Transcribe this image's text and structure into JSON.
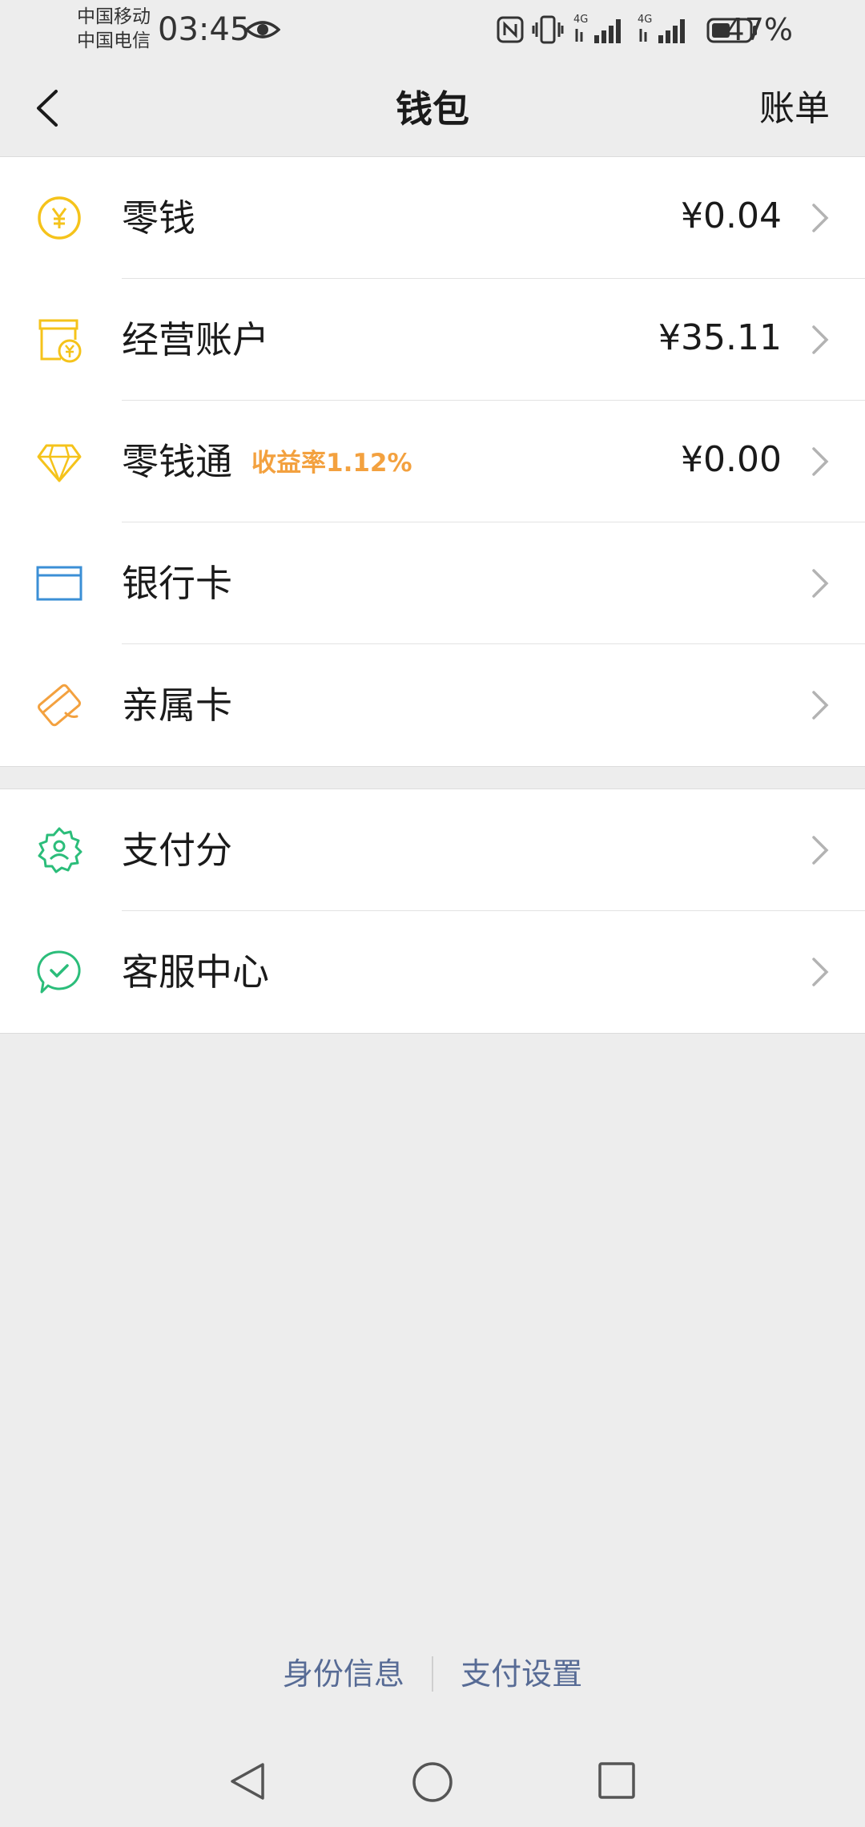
{
  "status_bar": {
    "carrier_1": "中国移动",
    "carrier_2": "中国电信",
    "time": "03:45",
    "battery": "47%",
    "signal_1_label": "4G",
    "signal_2_label": "4G"
  },
  "nav": {
    "title": "钱包",
    "right_action": "账单"
  },
  "groups": [
    {
      "items": [
        {
          "label": "零钱",
          "value": "¥0.04",
          "icon": "coin-yen-icon",
          "color": "#f5c31b"
        },
        {
          "label": "经营账户",
          "value": "¥35.11",
          "icon": "shop-account-icon",
          "color": "#f5c31b"
        },
        {
          "label": "零钱通",
          "badge": "收益率1.12%",
          "value": "¥0.00",
          "icon": "diamond-icon",
          "color": "#f5c31b"
        },
        {
          "label": "银行卡",
          "value": "",
          "icon": "bank-card-icon",
          "color": "#3b8fd6"
        },
        {
          "label": "亲属卡",
          "value": "",
          "icon": "family-card-icon",
          "color": "#f3a13f"
        }
      ]
    },
    {
      "items": [
        {
          "label": "支付分",
          "value": "",
          "icon": "pay-score-icon",
          "color": "#2bbd7a"
        },
        {
          "label": "客服中心",
          "value": "",
          "icon": "customer-service-icon",
          "color": "#2bbd7a"
        }
      ]
    }
  ],
  "footer": {
    "link_1": "身份信息",
    "link_2": "支付设置"
  },
  "colors": {
    "background": "#ededed",
    "link": "#576b95",
    "badge": "#f3a13f"
  }
}
